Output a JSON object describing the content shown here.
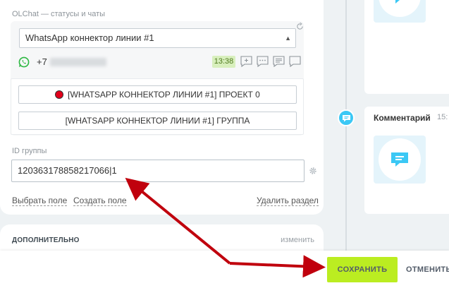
{
  "olchat": {
    "section_label": "OLChat — статусы и чаты",
    "connector_value": "WhatsApp коннектор линии #1",
    "phone_prefix": "+7",
    "time_badge": "13:38",
    "project_button": "[WHATSAPP КОННЕКТОР ЛИНИИ #1] ПРОЕКТ 0",
    "group_button": "[WHATSAPP КОННЕКТОР ЛИНИИ #1] ГРУППА"
  },
  "group_id": {
    "label": "ID группы",
    "value": "120363178858217066|1"
  },
  "links": {
    "select_field": "Выбрать поле",
    "create_field": "Создать поле",
    "delete_section": "Удалить раздел"
  },
  "extra": {
    "title": "ДОПОЛНИТЕЛЬНО",
    "change": "изменить"
  },
  "timeline": {
    "comment_title": "Комментарий",
    "comment_time": "15:"
  },
  "footer": {
    "save_label": "СОХРАНИТЬ",
    "cancel_label": "ОТМЕНИТЬ"
  },
  "colors": {
    "accent_green": "#bbed21",
    "timeline_blue": "#3bc8f5",
    "annotation_red": "#c0000d"
  },
  "icons": [
    "refresh-icon",
    "whatsapp-icon",
    "chat-icon",
    "gear-icon",
    "comment-icon"
  ]
}
